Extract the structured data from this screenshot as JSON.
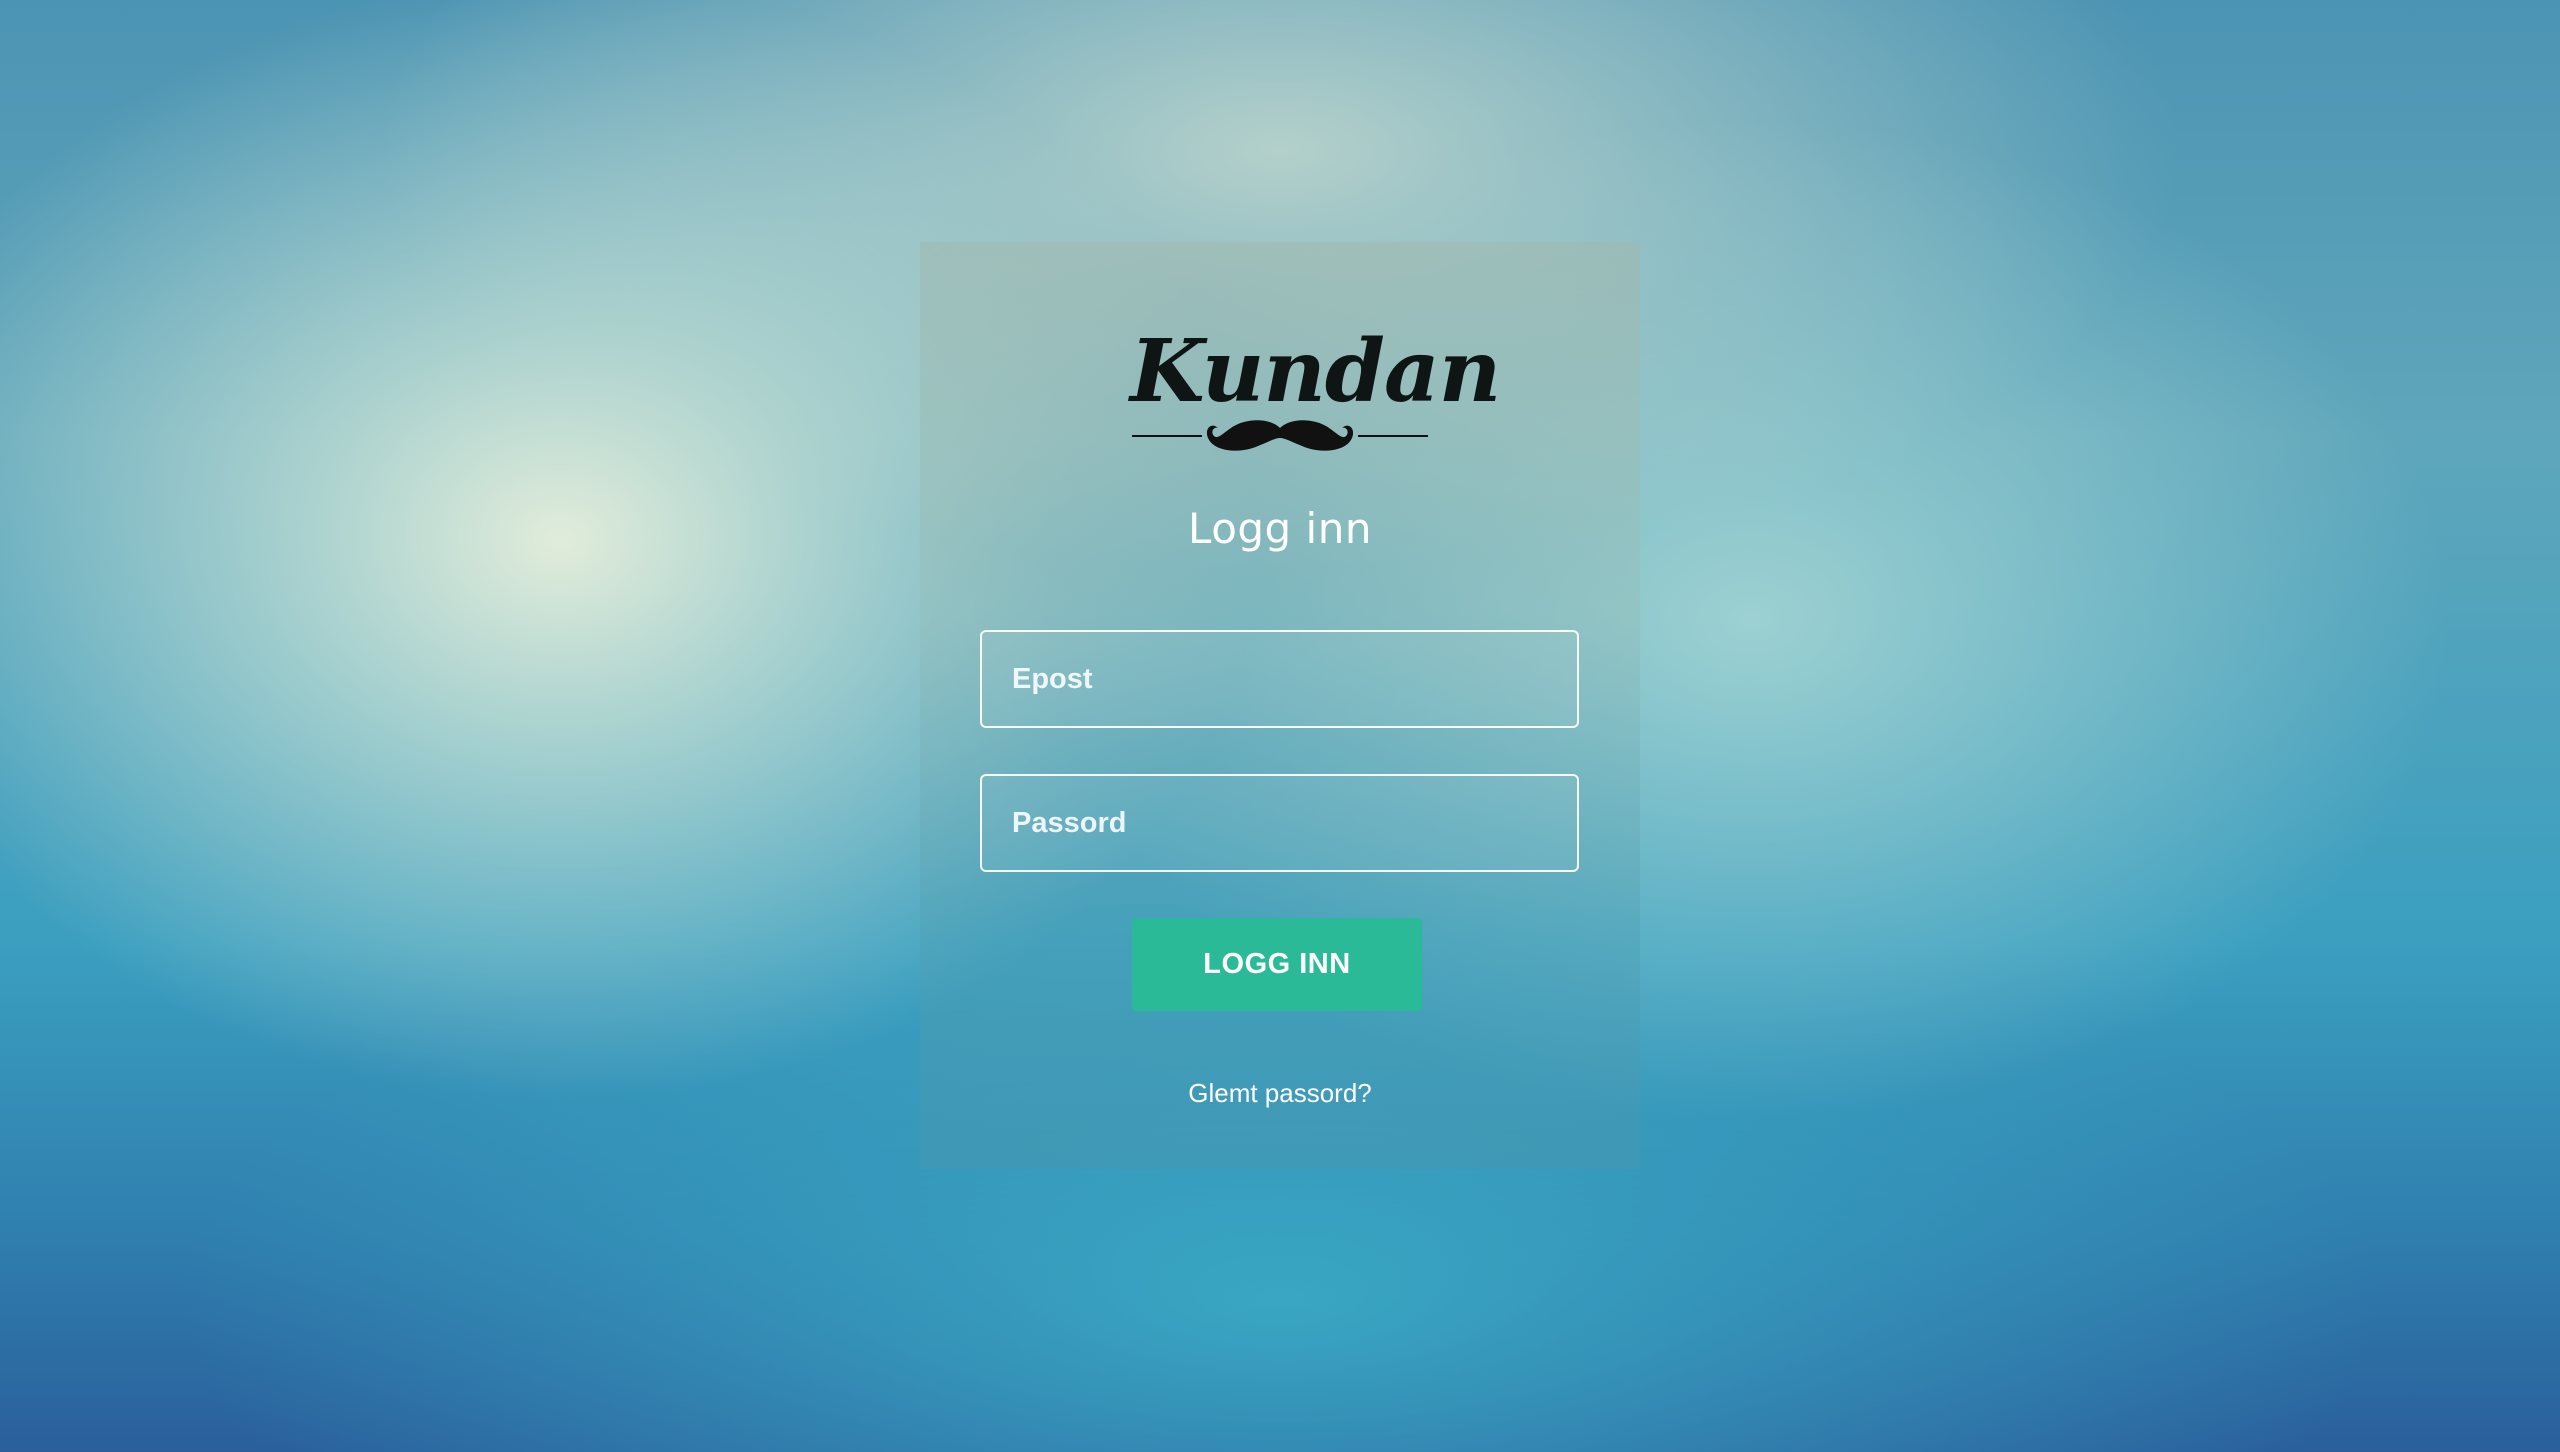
{
  "logo": {
    "text": "Kundan",
    "icon": "mustache-icon"
  },
  "heading": "Logg inn",
  "form": {
    "email_placeholder": "Epost",
    "email_value": "",
    "password_placeholder": "Passord",
    "password_value": "",
    "submit_label": "LOGG INN",
    "forgot_label": "Glemt passord?"
  },
  "colors": {
    "button": "#2aba98",
    "text": "#ffffff"
  }
}
